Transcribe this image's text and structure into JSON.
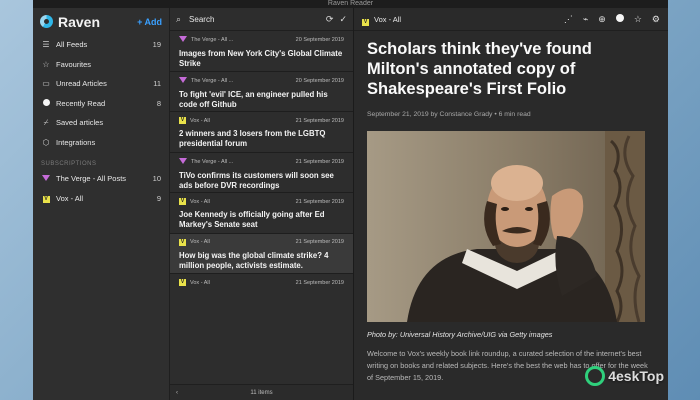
{
  "window": {
    "title": "Raven Reader"
  },
  "sidebar": {
    "app_name": "Raven",
    "add_label": "Add",
    "items": [
      {
        "icon": "list-icon",
        "label": "All Feeds",
        "count": "19"
      },
      {
        "icon": "star-icon",
        "label": "Favourites",
        "count": ""
      },
      {
        "icon": "unread-icon",
        "label": "Unread Articles",
        "count": "11"
      },
      {
        "icon": "dot-icon",
        "label": "Recently Read",
        "count": "8"
      },
      {
        "icon": "bookmark-icon",
        "label": "Saved articles",
        "count": ""
      },
      {
        "icon": "box-icon",
        "label": "Integrations",
        "count": ""
      }
    ],
    "subscriptions_heading": "SUBSCRIPTIONS",
    "subscriptions": [
      {
        "icon": "verge-icon",
        "label": "The Verge - All Posts",
        "count": "10"
      },
      {
        "icon": "vox-icon",
        "label": "Vox - All",
        "count": "9"
      }
    ]
  },
  "list": {
    "search_placeholder": "Search",
    "articles": [
      {
        "source": "The Verge - All ...",
        "icon": "verge-icon",
        "date": "20 September 2019",
        "title": "Images from New York City's Global Climate Strike"
      },
      {
        "source": "The Verge - All ...",
        "icon": "verge-icon",
        "date": "20 September 2019",
        "title": "To fight 'evil' ICE, an engineer pulled his code off Github"
      },
      {
        "source": "Vox - All",
        "icon": "vox-icon",
        "date": "21 September 2019",
        "title": "2 winners and 3 losers from the LGBTQ presidential forum"
      },
      {
        "source": "The Verge - All ...",
        "icon": "verge-icon",
        "date": "21 September 2019",
        "title": "TiVo confirms its customers will soon see ads before DVR recordings"
      },
      {
        "source": "Vox - All",
        "icon": "vox-icon",
        "date": "21 September 2019",
        "title": "Joe Kennedy is officially going after Ed Markey's Senate seat"
      },
      {
        "source": "Vox - All",
        "icon": "vox-icon",
        "date": "21 September 2019",
        "title": "How big was the global climate strike? 4 million people, activists estimate."
      },
      {
        "source": "Vox - All",
        "icon": "vox-icon",
        "date": "21 September 2019",
        "title": ""
      }
    ],
    "footer_count": "11 items"
  },
  "reader": {
    "feed_name": "Vox - All",
    "headline": "Scholars think they've found Milton's annotated copy of Shakespeare's First Folio",
    "byline": "September 21, 2019 by Constance Grady • 6 min read",
    "caption": "Photo by: Universal History Archive/UIG via Getty images",
    "body": "Welcome to Vox's weekly book link roundup, a curated selection of the internet's best writing on books and related subjects. Here's the best the web has to offer for the week of September 15, 2019."
  },
  "watermark": {
    "text": "4eskTop"
  },
  "colors": {
    "accent": "#3aa0ff",
    "verge": "#c56bd8",
    "vox": "#e9e24a",
    "logo": "#2fb7e8"
  }
}
